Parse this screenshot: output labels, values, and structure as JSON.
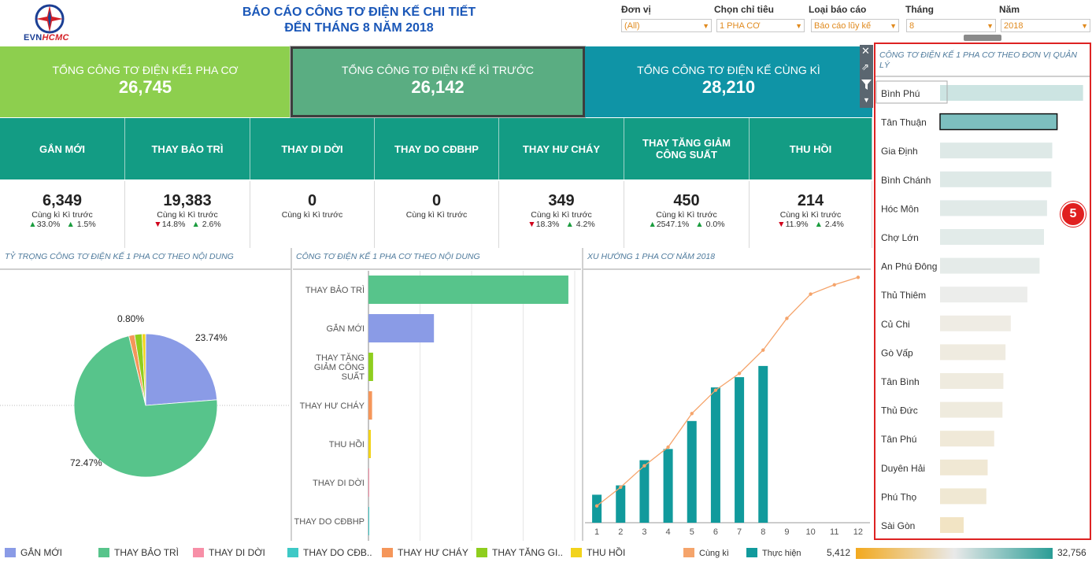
{
  "header": {
    "logo_text_a": "EVN",
    "logo_text_b": "HCMC",
    "title_line1": "BÁO CÁO CÔNG TƠ ĐIỆN KẾ CHI TIẾT",
    "title_line2": "ĐẾN THÁNG 8 NĂM 2018"
  },
  "filters": [
    {
      "label": "Đơn vị",
      "value": "(All)"
    },
    {
      "label": "Chọn chỉ tiêu",
      "value": "1 PHA CƠ"
    },
    {
      "label": "Loại báo cáo",
      "value": "Báo cáo lũy kế"
    },
    {
      "label": "Tháng",
      "value": "8"
    },
    {
      "label": "Năm",
      "value": "2018"
    }
  ],
  "kpis": [
    {
      "label": "TỔNG CÔNG TƠ ĐIỆN KẾ1 PHA CƠ",
      "value": "26,745",
      "color": "#8dcf4e"
    },
    {
      "label": "TỔNG CÔNG TƠ ĐIỆN KẾ KÌ TRƯỚC",
      "value": "26,142",
      "color": "#5aad82"
    },
    {
      "label": "TỔNG CÔNG TƠ ĐIỆN KẾ CÙNG KÌ",
      "value": "28,210",
      "color": "#0f94a6"
    }
  ],
  "categories": [
    {
      "name": "GẮN MỚI",
      "value": "6,349",
      "sub": "Cùng kì  Kì trước",
      "ck": "33.0%",
      "ck_dir": "up",
      "kt": "1.5%",
      "kt_dir": "up"
    },
    {
      "name": "THAY BẢO TRÌ",
      "value": "19,383",
      "sub": "Cùng kì  Kì trước",
      "ck": "14.8%",
      "ck_dir": "down",
      "kt": "2.6%",
      "kt_dir": "up"
    },
    {
      "name": "THAY DI DỜI",
      "value": "0",
      "sub": "Cùng kì  Kì trước",
      "ck": "",
      "ck_dir": "",
      "kt": "",
      "kt_dir": ""
    },
    {
      "name": "THAY DO CĐBHP",
      "value": "0",
      "sub": "Cùng kì  Kì trước",
      "ck": "",
      "ck_dir": "",
      "kt": "",
      "kt_dir": ""
    },
    {
      "name": "THAY HƯ CHÁY",
      "value": "349",
      "sub": "Cùng kì  Kì trước",
      "ck": "18.3%",
      "ck_dir": "down",
      "kt": "4.2%",
      "kt_dir": "up"
    },
    {
      "name": "THAY TĂNG GIẢM CÔNG SUẤT",
      "value": "450",
      "sub": "Cùng kì  Kì trước",
      "ck": "2547.1%",
      "ck_dir": "up",
      "kt": "0.0%",
      "kt_dir": "up"
    },
    {
      "name": "THU HỒI",
      "value": "214",
      "sub": "Cùng kì  Kì trước",
      "ck": "11.9%",
      "ck_dir": "down",
      "kt": "2.4%",
      "kt_dir": "up"
    }
  ],
  "sections": {
    "pie_title": "TỶ TRỌNG CÔNG TƠ ĐIỆN KẾ 1 PHA CƠ THEO NỘI DUNG",
    "bar_title": "CÔNG TƠ ĐIỆN KẾ 1 PHA CƠ THEO NỘI DUNG",
    "trend_title": "XU HƯỚNG 1 PHA CƠ NĂM 2018",
    "unit_title": "CÔNG TƠ ĐIỆN KẾ 1 PHA CƠ THEO ĐƠN VỊ QUẢN LÝ"
  },
  "badge": "5",
  "chart_data": [
    {
      "type": "pie",
      "slices": [
        {
          "name": "GẮN MỚI",
          "value": 23.74,
          "label": "23.74%",
          "color": "#8a9be6"
        },
        {
          "name": "THAY BẢO TRÌ",
          "value": 72.47,
          "label": "72.47%",
          "color": "#57c48b"
        },
        {
          "name": "THAY HƯ CHÁY",
          "value": 1.3,
          "label": "",
          "color": "#f5965a"
        },
        {
          "name": "THAY TĂNG GIẢM CÔNG SUẤT",
          "value": 1.68,
          "label": "",
          "color": "#8fce1e"
        },
        {
          "name": "THU HỒI",
          "value": 0.8,
          "label": "0.80%",
          "color": "#f2d31b"
        }
      ]
    },
    {
      "type": "bar",
      "orientation": "horizontal",
      "categories": [
        "THAY BẢO TRÌ",
        "GẮN MỚI",
        "THAY TĂNG GIẢM CÔNG SUẤT",
        "THAY HƯ CHÁY",
        "THU HỒI",
        "THAY DI DỜI",
        "THAY DO CĐBHP"
      ],
      "values": [
        19383,
        6349,
        450,
        349,
        214,
        0,
        0
      ],
      "colors": [
        "#57c48b",
        "#8a9be6",
        "#8fce1e",
        "#f5965a",
        "#f2d31b",
        "#f78fa7",
        "#3ec9c6"
      ],
      "xlim": [
        0,
        20000
      ]
    },
    {
      "type": "bar+line",
      "x": [
        1,
        2,
        3,
        4,
        5,
        6,
        7,
        8,
        9,
        10,
        11,
        12
      ],
      "bars_name": "Thực hiện",
      "bars": [
        3000,
        4000,
        6700,
        7900,
        10900,
        14500,
        15600,
        16800,
        null,
        null,
        null,
        null
      ],
      "line_name": "Cùng kì",
      "line": [
        1800,
        3800,
        6100,
        8100,
        11700,
        14200,
        16000,
        18500,
        21900,
        24500,
        25500,
        26300
      ],
      "bar_color": "#119a9c",
      "line_color": "#f5a46b",
      "ylim": [
        0,
        27000
      ]
    },
    {
      "type": "bar",
      "orientation": "horizontal",
      "categories": [
        "Bình Phú",
        "Tân Thuận",
        "Gia Định",
        "Bình Chánh",
        "Hóc Môn",
        "Chợ Lớn",
        "An Phú Đông",
        "Thủ Thiêm",
        "Củ Chi",
        "Gò Vấp",
        "Tân Bình",
        "Thủ Đức",
        "Tân Phú",
        "Duyên Hải",
        "Phú Thọ",
        "Sài Gòn"
      ],
      "values": [
        32756,
        26800,
        25700,
        25500,
        24500,
        23800,
        22800,
        20000,
        16200,
        15000,
        14500,
        14300,
        12400,
        10900,
        10600,
        5412
      ],
      "color_range": [
        "#f2a91e",
        "#e6e6e6",
        "#2a9d96"
      ],
      "color_range_min": "5,412",
      "color_range_max": "32,756",
      "xlim": [
        0,
        33000
      ]
    }
  ],
  "legend": {
    "items": [
      {
        "name": "GẮN MỚI",
        "color": "#8a9be6"
      },
      {
        "name": "THAY BẢO TRÌ",
        "color": "#57c48b"
      },
      {
        "name": "THAY DI DỜI",
        "color": "#f78fa7"
      },
      {
        "name": "THAY DO CĐB..",
        "color": "#3ec9c6"
      },
      {
        "name": "THAY HƯ CHÁY",
        "color": "#f5965a"
      },
      {
        "name": "THAY TĂNG GI..",
        "color": "#8fce1e"
      },
      {
        "name": "THU HỒI",
        "color": "#f2d31b"
      },
      {
        "name": "Cùng kì",
        "color": "#f5a46b"
      },
      {
        "name": "Thực hiện",
        "color": "#119a9c"
      }
    ]
  }
}
